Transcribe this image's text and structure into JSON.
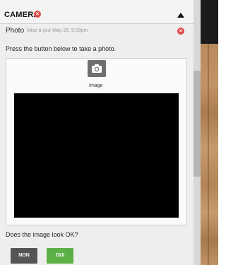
{
  "header": {
    "title": "CAMERA",
    "error_icon": "error-circle-icon",
    "collapse_icon": "triangle-up-icon"
  },
  "photo_field": {
    "label": "Photo",
    "meta": "Mise à jour May 26, 5:09pm",
    "clear_icon": "error-circle-icon"
  },
  "instruction": "Press the button below to take a photo.",
  "camera": {
    "icon": "camera-icon",
    "label": "Image"
  },
  "question": "Does the image look OK?",
  "buttons": {
    "no_label": "NON",
    "yes_label": "OUI"
  },
  "colors": {
    "error": "#e24b4b",
    "yes_button": "#5cb046",
    "no_button": "#555555",
    "preview": "#000000"
  }
}
